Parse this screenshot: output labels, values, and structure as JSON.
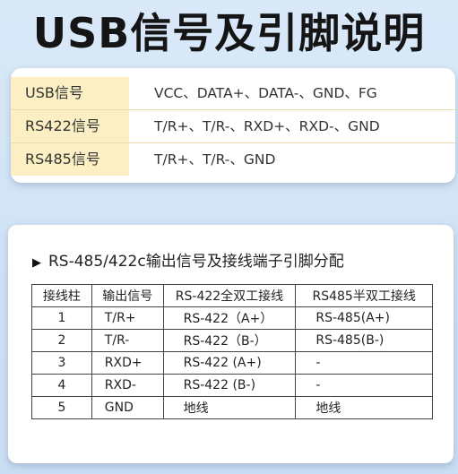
{
  "title": "USB信号及引脚说明",
  "signals": [
    {
      "label": "USB信号",
      "value": "VCC、DATA+、DATA-、GND、FG"
    },
    {
      "label": "RS422信号",
      "value": "T/R+、T/R-、RXD+、RXD-、GND"
    },
    {
      "label": "RS485信号",
      "value": "T/R+、T/R-、GND"
    }
  ],
  "pin_section": {
    "heading": "RS-485/422c输出信号及接线端子引脚分配",
    "headers": [
      "接线柱",
      "输出信号",
      "RS-422全双工接线",
      "RS485半双工接线"
    ],
    "rows": [
      [
        "1",
        "T/R+",
        "RS-422（A+）",
        "RS-485(A+)"
      ],
      [
        "2",
        "T/R-",
        "RS-422（B-）",
        "RS-485(B-)"
      ],
      [
        "3",
        "RXD+",
        "RS-422 (A+)",
        "-"
      ],
      [
        "4",
        "RXD-",
        "RS-422 (B-)",
        "-"
      ],
      [
        "5",
        "GND",
        "地线",
        "地线"
      ]
    ]
  }
}
